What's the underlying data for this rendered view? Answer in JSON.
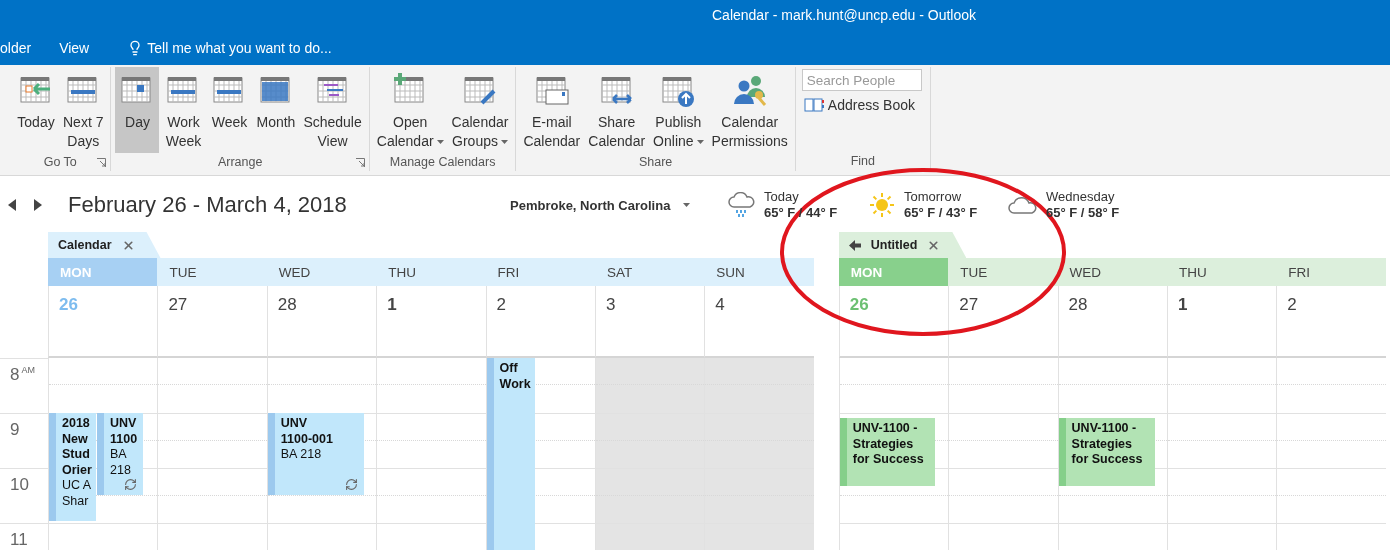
{
  "window": {
    "title": "Calendar - mark.hunt@uncp.edu - Outlook"
  },
  "menu": {
    "items": [
      "older",
      "View"
    ],
    "tell_me": "Tell me what you want to do..."
  },
  "ribbon": {
    "groups": [
      {
        "label": "Go To",
        "launcher": true,
        "buttons": [
          {
            "kind": "today",
            "label": "Today",
            "selected": false,
            "dropdown": false
          },
          {
            "kind": "next7",
            "label": "Next 7\nDays",
            "selected": false,
            "dropdown": false
          }
        ]
      },
      {
        "label": "Arrange",
        "launcher": true,
        "buttons": [
          {
            "kind": "day",
            "label": "Day",
            "selected": true,
            "dropdown": false
          },
          {
            "kind": "workweek",
            "label": "Work\nWeek",
            "selected": false,
            "dropdown": false
          },
          {
            "kind": "week",
            "label": "Week",
            "selected": false,
            "dropdown": false
          },
          {
            "kind": "month",
            "label": "Month",
            "selected": false,
            "dropdown": false
          },
          {
            "kind": "schedule",
            "label": "Schedule\nView",
            "selected": false,
            "dropdown": false
          }
        ]
      },
      {
        "label": "Manage Calendars",
        "launcher": false,
        "buttons": [
          {
            "kind": "open",
            "label": "Open\nCalendar",
            "selected": false,
            "dropdown": true
          },
          {
            "kind": "groups",
            "label": "Calendar\nGroups",
            "selected": false,
            "dropdown": true
          }
        ]
      },
      {
        "label": "Share",
        "launcher": false,
        "buttons": [
          {
            "kind": "email",
            "label": "E-mail\nCalendar",
            "selected": false,
            "dropdown": false
          },
          {
            "kind": "share",
            "label": "Share\nCalendar",
            "selected": false,
            "dropdown": false
          },
          {
            "kind": "publish",
            "label": "Publish\nOnline",
            "selected": false,
            "dropdown": true
          },
          {
            "kind": "permissions",
            "label": "Calendar\nPermissions",
            "selected": false,
            "dropdown": false
          }
        ]
      },
      {
        "label": "Find",
        "launcher": false,
        "search_placeholder": "Search People",
        "address_book": "Address Book"
      }
    ]
  },
  "nav": {
    "range": "February 26 - March 4, 2018",
    "location": "Pembroke, North Carolina",
    "weather": [
      {
        "kind": "rain",
        "day": "Today",
        "temps": "65° F / 44° F"
      },
      {
        "kind": "sun",
        "day": "Tomorrow",
        "temps": "65° F / 43° F"
      },
      {
        "kind": "cloud",
        "day": "Wednesday",
        "temps": "65° F / 58° F"
      }
    ]
  },
  "hours": [
    {
      "label": "8",
      "suffix": "AM"
    },
    {
      "label": "9"
    },
    {
      "label": "10"
    },
    {
      "label": "11"
    }
  ],
  "calendars": [
    {
      "tab": "Calendar",
      "kind": "blue",
      "back_arrow": false,
      "days": [
        {
          "dow": "MON",
          "date": "26",
          "today": true,
          "first_of_month": false,
          "weekend": false,
          "events": [
            {
              "title": "2018 New Stud Orier",
              "location": "UC A Shar",
              "recurring": false
            },
            {
              "title": "UNV 1100",
              "location": "BA 218",
              "recurring": true
            }
          ]
        },
        {
          "dow": "TUE",
          "date": "27",
          "today": false,
          "first_of_month": false,
          "weekend": false
        },
        {
          "dow": "WED",
          "date": "28",
          "today": false,
          "first_of_month": false,
          "weekend": false,
          "events": [
            {
              "title": "UNV 1100-001",
              "location": "BA 218",
              "recurring": true
            }
          ]
        },
        {
          "dow": "THU",
          "date": "1",
          "today": false,
          "first_of_month": true,
          "weekend": false
        },
        {
          "dow": "FRI",
          "date": "2",
          "today": false,
          "first_of_month": false,
          "weekend": false,
          "events": [
            {
              "title": "Off Work",
              "recurring": false
            }
          ]
        },
        {
          "dow": "SAT",
          "date": "3",
          "today": false,
          "first_of_month": false,
          "weekend": true
        },
        {
          "dow": "SUN",
          "date": "4",
          "today": false,
          "first_of_month": false,
          "weekend": true
        }
      ]
    },
    {
      "tab": "Untitled",
      "kind": "green",
      "back_arrow": true,
      "days": [
        {
          "dow": "MON",
          "date": "26",
          "today": true,
          "first_of_month": false,
          "weekend": false,
          "events": [
            {
              "title": "UNV-1100 - Strategies for Success",
              "recurring": false
            }
          ]
        },
        {
          "dow": "TUE",
          "date": "27",
          "today": false,
          "first_of_month": false,
          "weekend": false
        },
        {
          "dow": "WED",
          "date": "28",
          "today": false,
          "first_of_month": false,
          "weekend": false,
          "events": [
            {
              "title": "UNV-1100 - Strategies for Success",
              "recurring": false
            }
          ]
        },
        {
          "dow": "THU",
          "date": "1",
          "today": false,
          "first_of_month": true,
          "weekend": false
        },
        {
          "dow": "FRI",
          "date": "2",
          "today": false,
          "first_of_month": false,
          "weekend": false
        }
      ]
    }
  ]
}
